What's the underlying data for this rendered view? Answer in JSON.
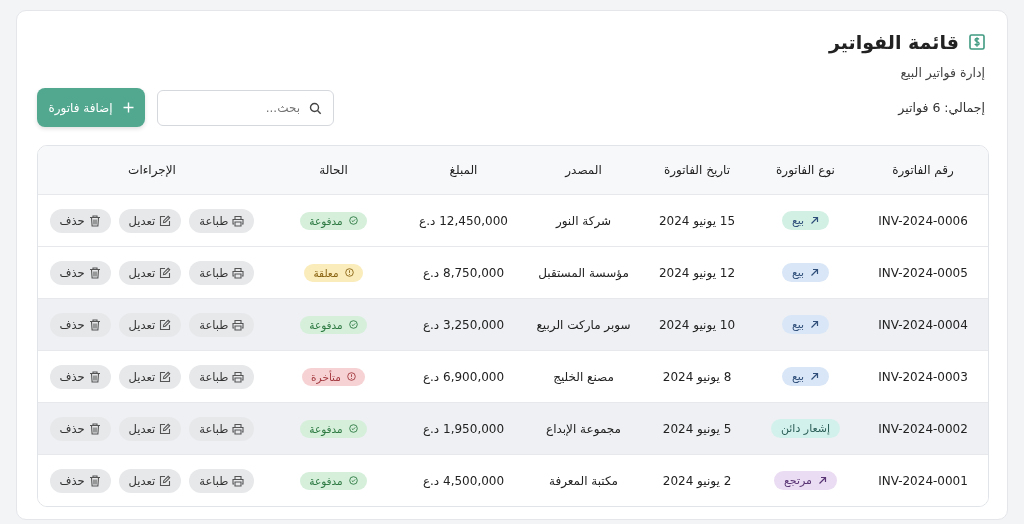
{
  "header": {
    "title": "قائمة الفواتير",
    "subtitle": "إدارة فواتير البيع"
  },
  "toolbar": {
    "total": "إجمالي: 6 فواتير",
    "search": {
      "placeholder": "بحث..."
    },
    "add_button": "إضافة فاتورة"
  },
  "table": {
    "columns": [
      "رقم الفاتورة",
      "نوع الفاتورة",
      "تاريخ الفاتورة",
      "المصدر",
      "المبلغ",
      "الحالة",
      "الإجراءات"
    ],
    "rows": [
      {
        "number": "INV-2024-0006",
        "type": {
          "label": "بيع",
          "kind": "sale",
          "color": "#d3f0e4"
        },
        "date": "15 يونيو 2024",
        "source": "شركة النور",
        "amount": "12,450,000 د.ع",
        "status": {
          "label": "مدفوعة",
          "kind": "paid"
        },
        "highlighted": false,
        "actions": [
          "طباعة",
          "تعديل",
          "حذف"
        ]
      },
      {
        "number": "INV-2024-0005",
        "type": {
          "label": "بيع",
          "kind": "sale",
          "color": "#d9e6f7"
        },
        "date": "12 يونيو 2024",
        "source": "مؤسسة المستقبل",
        "amount": "8,750,000 د.ع",
        "status": {
          "label": "معلقة",
          "kind": "pending"
        },
        "highlighted": false,
        "actions": [
          "طباعة",
          "تعديل",
          "حذف"
        ]
      },
      {
        "number": "INV-2024-0004",
        "type": {
          "label": "بيع",
          "kind": "sale",
          "color": "#d9e6f7"
        },
        "date": "10 يونيو 2024",
        "source": "سوبر ماركت الربيع",
        "amount": "3,250,000 د.ع",
        "status": {
          "label": "مدفوعة",
          "kind": "paid"
        },
        "highlighted": true,
        "actions": [
          "طباعة",
          "تعديل",
          "حذف"
        ]
      },
      {
        "number": "INV-2024-0003",
        "type": {
          "label": "بيع",
          "kind": "sale",
          "color": "#d9e6f7"
        },
        "date": "8 يونيو 2024",
        "source": "مصنع الخليج",
        "amount": "6,900,000 د.ع",
        "status": {
          "label": "متأخرة",
          "kind": "overdue"
        },
        "highlighted": false,
        "actions": [
          "طباعة",
          "تعديل",
          "حذف"
        ]
      },
      {
        "number": "INV-2024-0002",
        "type": {
          "label": "إشعار دائن",
          "kind": "credit",
          "color": "#d3f1ec"
        },
        "date": "5 يونيو 2024",
        "source": "مجموعة الإبداع",
        "amount": "1,950,000 د.ع",
        "status": {
          "label": "مدفوعة",
          "kind": "paid"
        },
        "highlighted": true,
        "actions": [
          "طباعة",
          "تعديل",
          "حذف"
        ]
      },
      {
        "number": "INV-2024-0001",
        "type": {
          "label": "مرتجع",
          "kind": "return",
          "color": "#eadcf2"
        },
        "date": "2 يونيو 2024",
        "source": "مكتبة المعرفة",
        "amount": "4,500,000 د.ع",
        "status": {
          "label": "مدفوعة",
          "kind": "paid"
        },
        "highlighted": false,
        "actions": [
          "طباعة",
          "تعديل",
          "حذف"
        ]
      }
    ]
  }
}
